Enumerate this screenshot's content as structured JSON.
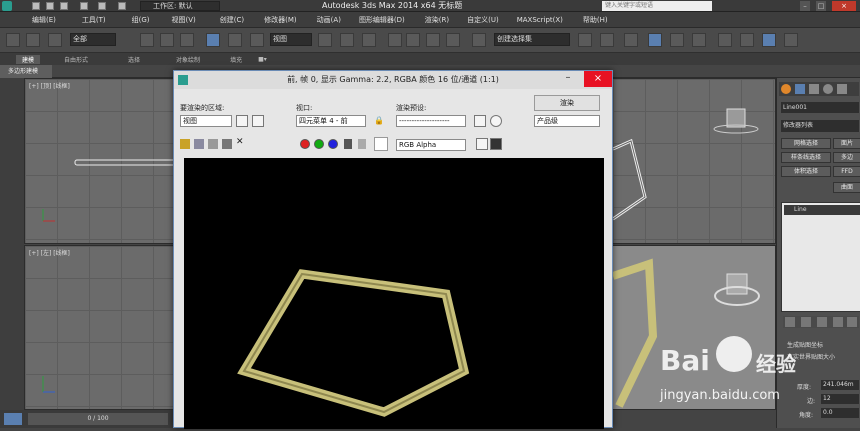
{
  "titlebar": {
    "workspace": "工作区: 默认",
    "app_title": "Autodesk 3ds Max  2014 x64      无标题",
    "search_placeholder": "键入关键字或短语"
  },
  "menu": [
    "编辑(E)",
    "工具(T)",
    "组(G)",
    "视图(V)",
    "创建(C)",
    "修改器(M)",
    "动画(A)",
    "图形编辑器(D)",
    "渲染(R)",
    "自定义(U)",
    "MAXScript(X)",
    "帮助(H)"
  ],
  "toolbar": {
    "selection_filter": "全部",
    "ref_coord": "视图",
    "named_sel": "创建选择集"
  },
  "ribbon": {
    "tabs": [
      "建模",
      "自由形式",
      "选择",
      "对象绘制",
      "填充"
    ],
    "active_tab": "建模",
    "subtab": "多边形建模"
  },
  "viewports": {
    "top_left": "[+] [顶] [线框]",
    "bottom_left": "[+] [左] [线框]"
  },
  "render_window": {
    "title": "前, 帧 0, 显示 Gamma: 2.2, RGBA 颜色 16 位/通道 (1:1)",
    "area_label": "要渲染的区域:",
    "area_value": "视图",
    "viewport_label": "视口:",
    "viewport_value": "四元菜单 4 - 前",
    "preset_label": "渲染预设:",
    "preset_value": "--------------------",
    "render_button": "渲染",
    "quality_value": "产品级",
    "channel_value": "RGB Alpha",
    "shape_color": "#c8c07a"
  },
  "command_panel": {
    "object_name": "Line001",
    "modifier_list": "修改器列表",
    "buttons": [
      "网格选择",
      "面片",
      "样条线选择",
      "多边",
      "体积选择",
      "FFD",
      "曲面"
    ],
    "stack_item": "Line",
    "spinner1_label": "厚度:",
    "spinner1_value": "241.046m",
    "spinner2_label": "边:",
    "spinner2_value": "12",
    "spinner3_label": "角度:",
    "spinner3_value": "0.0",
    "check_label": "真实世界贴图大小",
    "gen_label": "生成贴图坐标"
  },
  "status": {
    "timeline": "0 / 100"
  },
  "watermark": {
    "brand": "Bai",
    "brand2": "经验",
    "url": "jingyan.baidu.com"
  }
}
